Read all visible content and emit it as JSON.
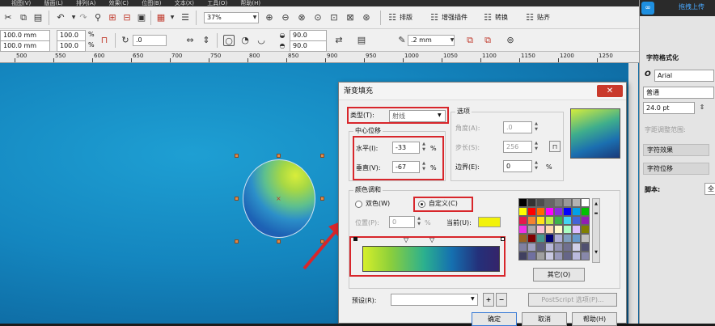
{
  "menubar": {
    "items": [
      "视图(V)",
      "版面(L)",
      "排列(A)",
      "效果(C)",
      "位图(B)",
      "文本(X)",
      "工具(O)",
      "帮助(H)"
    ]
  },
  "toolbar1": {
    "zoom": "37%",
    "buttons": [
      "排版",
      "增强插件",
      "转换",
      "贴齐"
    ]
  },
  "toolbar2": {
    "width": "100.0 mm",
    "height": "100.0 mm",
    "scale_x": "100.0",
    "scale_y": "100.0",
    "percent": "%",
    "rotation": ".0",
    "angle1": "90.0",
    "angle2": "90.0",
    "outline": ".2 mm"
  },
  "ruler": {
    "labels": [
      "500",
      "550",
      "600",
      "650",
      "700",
      "750",
      "800",
      "850",
      "900",
      "950",
      "1000",
      "1050",
      "1100",
      "1150",
      "1200",
      "1250"
    ]
  },
  "right_panel": {
    "upload": "拖拽上传",
    "header": "字符格式化",
    "font": "Arial",
    "style": "普通",
    "size": "24.0 pt",
    "range_label": "字距调整范围:",
    "effects": "字符效果",
    "offset": "字符位移",
    "script_label": "脚本:",
    "script_value": "全"
  },
  "dialog": {
    "title": "渐变填充",
    "type_label": "类型(T):",
    "type_value": "射线",
    "center_group": "中心位移",
    "horizontal_label": "水平(I):",
    "horizontal_value": "-33",
    "vertical_label": "垂直(V):",
    "vertical_value": "-67",
    "options_group": "选项",
    "angle_label": "角度(A):",
    "angle_value": ".0",
    "steps_label": "步长(S):",
    "steps_value": "256",
    "edge_label": "边界(E):",
    "edge_value": "0",
    "percent": "%",
    "blend_group": "颜色调和",
    "two_color": "双色(W)",
    "custom": "自定义(C)",
    "position_label": "位置(P):",
    "position_value": "0",
    "current_label": "当前(U):",
    "current_color": "#f2f20a",
    "others_button": "其它(O)",
    "preset_label": "预设(R):",
    "postscript_button": "PostScript 选项(P)...",
    "ok_button": "确定",
    "cancel_button": "取消",
    "help_button": "帮助(H)",
    "palette": [
      "#000000",
      "#333333",
      "#4d4d4d",
      "#666666",
      "#808080",
      "#999999",
      "#b3b3b3",
      "#ffffff",
      "#ffff00",
      "#ff0000",
      "#ff6a00",
      "#ff00ff",
      "#8a2be2",
      "#0000ff",
      "#00a0e9",
      "#00c000",
      "#e6194b",
      "#f58231",
      "#ffe119",
      "#bfef45",
      "#3cb44b",
      "#42d4f4",
      "#4363d8",
      "#911eb4",
      "#f032e6",
      "#a9a9a9",
      "#fabed4",
      "#ffd8b1",
      "#fffac8",
      "#aaffc3",
      "#dcbeff",
      "#808000",
      "#9a6324",
      "#800000",
      "#469990",
      "#000075",
      "#b0b0d8",
      "#7fa0c0",
      "#6699cc",
      "#c0c0c0",
      "#8080a0",
      "#a0a0c0",
      "#606080",
      "#b8b8d8",
      "#9090b0",
      "#707090",
      "#d0d0e8",
      "#505070",
      "#404060",
      "#7070a0",
      "#a0a0a0",
      "#c8c8e0",
      "#9999bb",
      "#666688",
      "#bbbbdd",
      "#8888aa"
    ]
  }
}
